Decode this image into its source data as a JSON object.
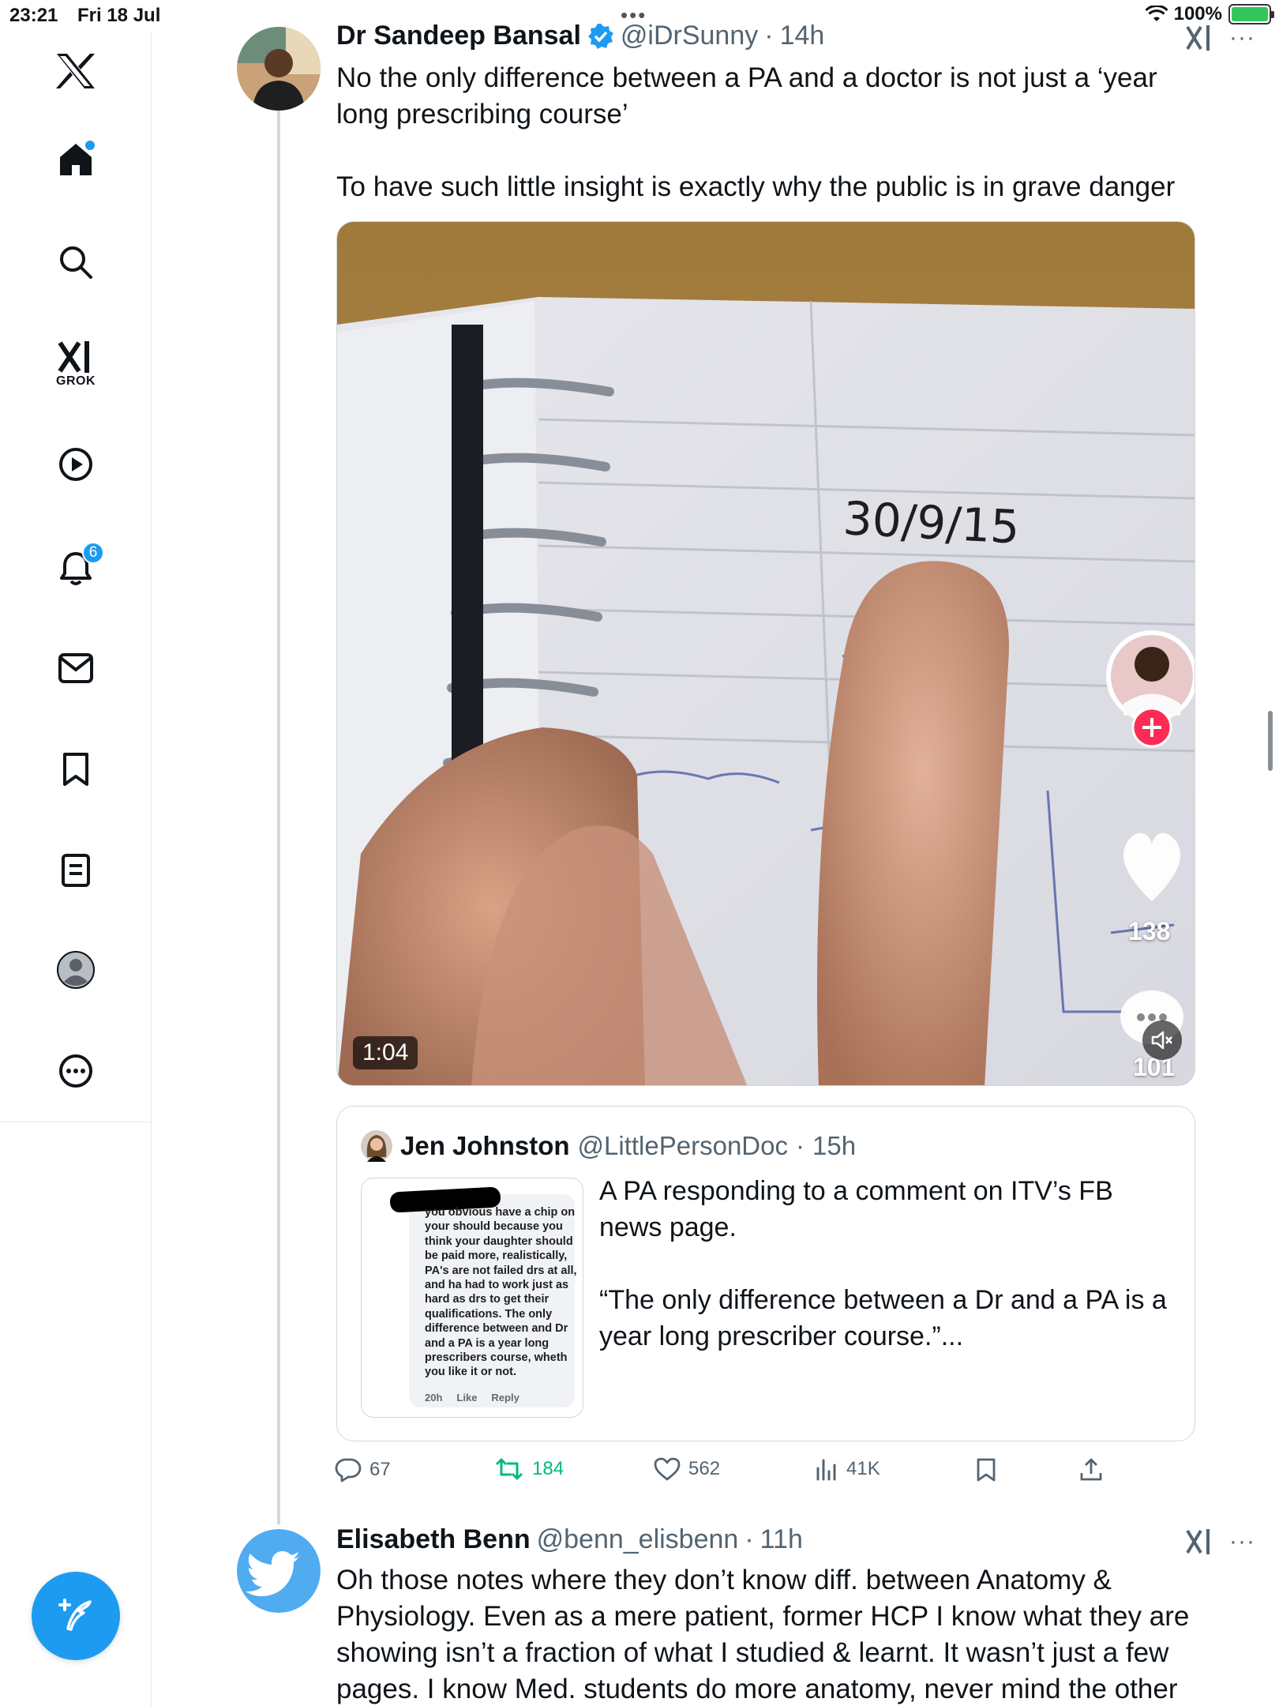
{
  "status_bar": {
    "time": "23:21",
    "date": "Fri 18 Jul",
    "battery": "100%"
  },
  "sidebar": {
    "items": [
      {
        "name": "x-logo-icon"
      },
      {
        "name": "home-icon"
      },
      {
        "name": "search-icon"
      },
      {
        "name": "grok-icon",
        "label": "GROK"
      },
      {
        "name": "video-icon"
      },
      {
        "name": "notifications-icon",
        "badge": "6"
      },
      {
        "name": "messages-icon"
      },
      {
        "name": "bookmarks-icon"
      },
      {
        "name": "lists-icon"
      },
      {
        "name": "profile-icon"
      },
      {
        "name": "more-icon"
      }
    ],
    "compose_icon": "compose-icon"
  },
  "tweet_main": {
    "display_name": "Dr Sandeep Bansal",
    "handle": "@iDrSunny",
    "separator": "·",
    "time": "14h",
    "more": "···",
    "text_p1": "No the only difference between a PA and a doctor is not just a ‘year long prescribing course’",
    "text_p2": "To have such little insight is exactly why the public is in grave danger",
    "video": {
      "duration": "1:04",
      "overlay_date": "30/9/15",
      "like_count": "138",
      "comment_count": "101"
    }
  },
  "quoted_tweet": {
    "display_name": "Jen Johnston",
    "handle": "@LittlePersonDoc",
    "separator": "·",
    "time": "15h",
    "text_p1": "A PA responding to a comment on ITV’s FB news page.",
    "text_p2": "“The only difference between a Dr and a PA is a year long prescriber course.”...",
    "thumbnail_text": "you obvious have a chip on your should because you think your daughter should be paid more, realistically, PA's are not failed drs at all, and ha had to work just as hard as drs to get their qualifications. The only difference between and Dr and a PA is a year long prescribers course, wheth you like it or not.",
    "thumbnail_meta": [
      "20h",
      "Like",
      "Reply"
    ]
  },
  "actions": {
    "replies": "67",
    "retweets": "184",
    "likes": "562",
    "views": "41K"
  },
  "tweet_reply": {
    "display_name": "Elisabeth Benn",
    "handle": "@benn_elisbenn",
    "separator": "·",
    "time": "11h",
    "more": "···",
    "text": "Oh those notes where they don’t know diff.  between Anatomy & Physiology. Even as a mere patient, former HCP I know what they are showing isn’t a fraction of  what I studied & learnt. It wasn’t just a few pages. I know Med. students  do more anatomy, never mind the other"
  },
  "colors": {
    "accent": "#1d9bf0",
    "retweet_green": "#00ba7c",
    "secondary_text": "#536471",
    "border": "#cfd9de"
  }
}
